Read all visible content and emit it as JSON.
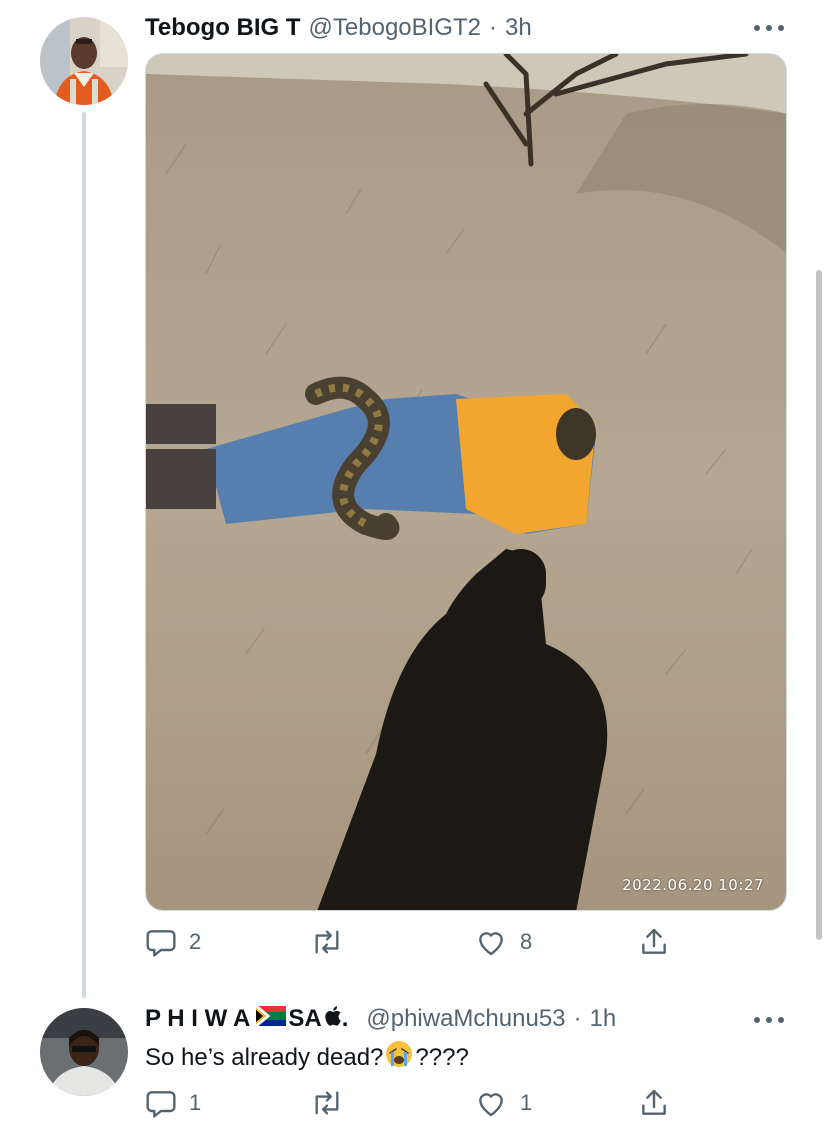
{
  "tweet": {
    "display_name": "Tebogo BIG T",
    "handle": "@TebogoBIGT2",
    "separator": "·",
    "time": "3h",
    "media_timestamp": "2022.06.20 10:27",
    "reply_count": "2",
    "retweet_count": "",
    "like_count": "8"
  },
  "reply": {
    "display_name": "P H I W A",
    "name_suffix": "SA",
    "name_end": ".",
    "handle": "@phiwaMchunu53",
    "separator": "·",
    "time": "1h",
    "text_before_emoji": "So he’s already dead?",
    "text_after_emoji": "????",
    "reply_count": "1",
    "retweet_count": "",
    "like_count": "1"
  },
  "colors": {
    "text_primary": "#0f1419",
    "text_secondary": "#536471",
    "thread_line": "#cfd9de"
  },
  "icons": [
    "reply-icon",
    "retweet-icon",
    "like-icon",
    "share-icon",
    "more-icon",
    "crying-emoji-icon",
    "south-africa-flag-icon",
    "apple-logo-icon"
  ]
}
